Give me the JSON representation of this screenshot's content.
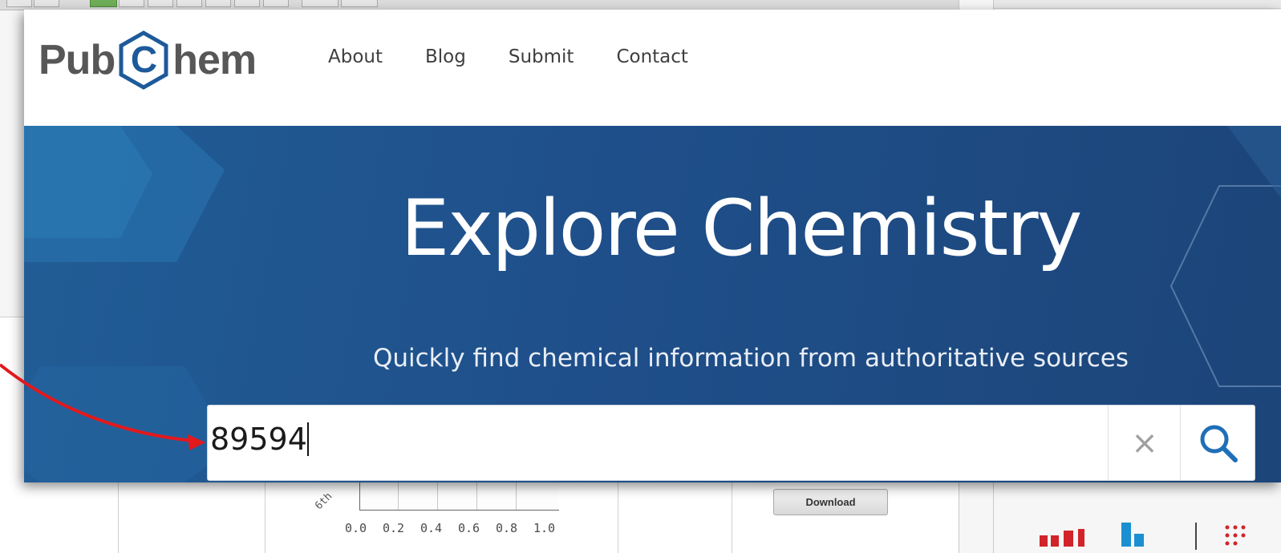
{
  "background": {
    "download_label": "Download",
    "axis_ticks": [
      "0.0",
      "0.2",
      "0.4",
      "0.6",
      "0.8",
      "1.0"
    ],
    "rotated_label": "6th"
  },
  "header": {
    "logo_left": "Pub",
    "logo_mid": "C",
    "logo_right": "hem",
    "nav": [
      "About",
      "Blog",
      "Submit",
      "Contact"
    ]
  },
  "hero": {
    "title": "Explore Chemistry",
    "subtitle": "Quickly find chemical information from authoritative sources"
  },
  "search": {
    "value": "89594",
    "clear_symbol": "×"
  },
  "colors": {
    "brand_blue": "#1e5a9a",
    "hero_bg": "#1f4f8a",
    "annotation_red": "#e3191c"
  },
  "icons": {
    "logo": "hexagon-c-logo-icon",
    "clear": "close-icon",
    "search": "search-icon",
    "annotation": "red-arrow-icon"
  }
}
